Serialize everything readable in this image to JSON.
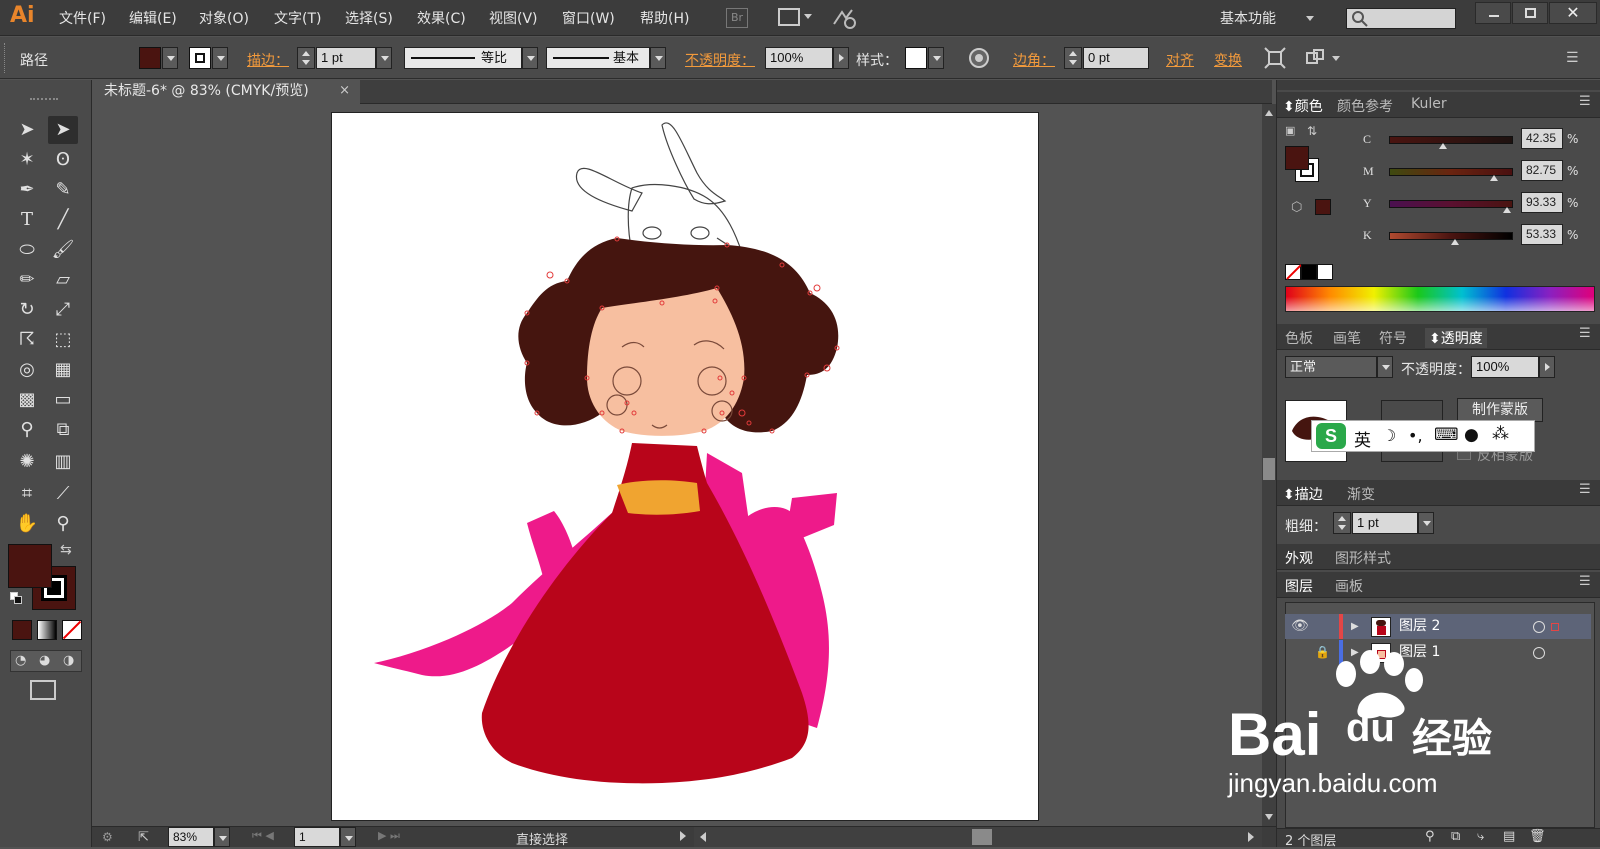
{
  "app": {
    "logo": "Ai",
    "menu": [
      "文件(F)",
      "编辑(E)",
      "对象(O)",
      "文字(T)",
      "选择(S)",
      "效果(C)",
      "视图(V)",
      "窗口(W)",
      "帮助(H)"
    ],
    "bridge_label": "Br",
    "workspace": "基本功能"
  },
  "control": {
    "selection_type": "路径",
    "stroke_label": "描边：",
    "stroke_weight": "1 pt",
    "profile_label": "等比",
    "brush_label": "基本",
    "opacity_label": "不透明度：",
    "opacity_value": "100%",
    "style_label": "样式：",
    "corner_label": "边角：",
    "corner_value": "0 pt",
    "align_label": "对齐",
    "transform_label": "变换"
  },
  "document": {
    "tab_title": "未标题-6* @ 83% (CMYK/预览)",
    "close_glyph": "×"
  },
  "status": {
    "zoom": "83%",
    "artboard": "1",
    "tool": "直接选择"
  },
  "color_panel": {
    "tabs": [
      "颜色",
      "颜色参考",
      "Kuler"
    ],
    "channels": [
      {
        "label": "C",
        "value": "42.35",
        "pos": 0.42
      },
      {
        "label": "M",
        "value": "82.75",
        "pos": 0.83
      },
      {
        "label": "Y",
        "value": "93.33",
        "pos": 0.93
      },
      {
        "label": "K",
        "value": "53.33",
        "pos": 0.53
      }
    ],
    "unit": "%",
    "fill_color": "#4a1410"
  },
  "transparency_panel": {
    "tabs": [
      "色板",
      "画笔",
      "符号",
      "透明度"
    ],
    "mode": "正常",
    "opacity_label": "不透明度：",
    "opacity_value": "100%",
    "make_mask": "制作蒙版",
    "invert_mask": "反相蒙版"
  },
  "ime": {
    "lang": "英"
  },
  "stroke_panel": {
    "tabs": [
      "描边",
      "渐变"
    ],
    "weight_label": "粗细：",
    "weight_value": "1 pt"
  },
  "appearance_panel": {
    "tabs": [
      "外观",
      "图形样式"
    ]
  },
  "layers_panel": {
    "tabs": [
      "图层",
      "画板"
    ],
    "layers": [
      {
        "name": "图层 2",
        "color": "#e34646"
      },
      {
        "name": "图层 1",
        "color": "#4a6ee3"
      }
    ],
    "count": "2 个图层"
  },
  "watermark": {
    "brand": "Bai",
    "brand2": "du",
    "cn": "经验",
    "url": "jingyan.baidu.com"
  },
  "colors": {
    "hair": "#45150f",
    "face": "#f7bfa0",
    "dress": "#b8051a",
    "sleeve": "#ee1a8a",
    "belt": "#f0a430"
  }
}
